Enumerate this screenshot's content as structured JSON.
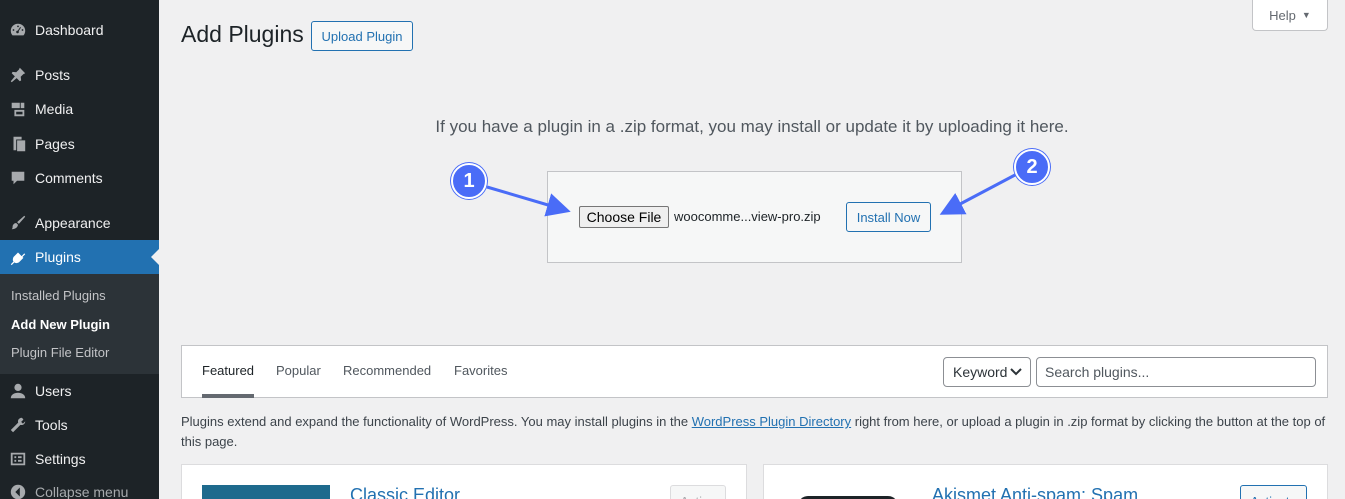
{
  "sidebar": {
    "items": [
      {
        "label": "Dashboard",
        "icon": "dashboard-icon"
      },
      {
        "label": "Posts",
        "icon": "pin-icon"
      },
      {
        "label": "Media",
        "icon": "media-icon"
      },
      {
        "label": "Pages",
        "icon": "pages-icon"
      },
      {
        "label": "Comments",
        "icon": "comments-icon"
      },
      {
        "label": "Appearance",
        "icon": "brush-icon"
      },
      {
        "label": "Plugins",
        "icon": "plugin-icon"
      },
      {
        "label": "Users",
        "icon": "users-icon"
      },
      {
        "label": "Tools",
        "icon": "wrench-icon"
      },
      {
        "label": "Settings",
        "icon": "settings-icon"
      },
      {
        "label": "Collapse menu",
        "icon": "collapse-icon"
      }
    ],
    "submenu": [
      "Installed Plugins",
      "Add New Plugin",
      "Plugin File Editor"
    ]
  },
  "header": {
    "title": "Add Plugins",
    "upload_button": "Upload Plugin",
    "help_button": "Help"
  },
  "upload": {
    "instructions": "If you have a plugin in a .zip format, you may install or update it by uploading it here.",
    "choose_file_label": "Choose File",
    "file_name": "woocomme...view-pro.zip",
    "install_button": "Install Now"
  },
  "annotations": {
    "marker1": "1",
    "marker2": "2",
    "marker_color": "#4a6cf7"
  },
  "filter": {
    "tabs": [
      "Featured",
      "Popular",
      "Recommended",
      "Favorites"
    ],
    "search_type": "Keyword",
    "search_placeholder": "Search plugins..."
  },
  "description": {
    "before_link": "Plugins extend and expand the functionality of WordPress. You may install plugins in the ",
    "link": "WordPress Plugin Directory",
    "after_link": " right from here, or upload a plugin in .zip format by clicking the button at the top of this page."
  },
  "cards": [
    {
      "title": "Classic Editor",
      "button": "Active"
    },
    {
      "title": "Akismet Anti-spam: Spam",
      "button": "Activate"
    }
  ],
  "colors": {
    "sidebar_bg": "#1d2327",
    "accent": "#2271b1",
    "page_bg": "#f0f0f1"
  }
}
